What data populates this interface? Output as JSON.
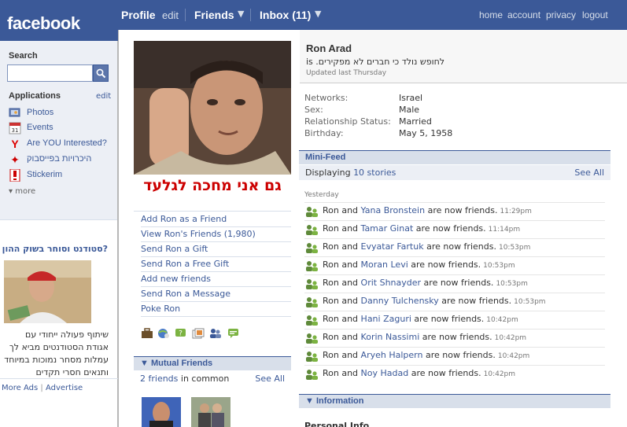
{
  "brand": {
    "logo_text": "facebook"
  },
  "topnav": {
    "profile": "Profile",
    "edit": "edit",
    "friends": "Friends",
    "inbox": "Inbox (11)",
    "home": "home",
    "account": "account",
    "privacy": "privacy",
    "logout": "logout"
  },
  "sidebar": {
    "search_label": "Search",
    "applications_label": "Applications",
    "applications_edit": "edit",
    "apps": [
      {
        "label": "Photos",
        "icon": "photos-icon"
      },
      {
        "label": "Events",
        "icon": "calendar-icon"
      },
      {
        "label": "Are YOU Interested?",
        "icon": "y-icon"
      },
      {
        "label": "היכרויות בפייסבוק",
        "icon": "heart-icon"
      },
      {
        "label": "Stickerim",
        "icon": "exclamation-icon"
      }
    ],
    "more": "more",
    "ad_title": "?סטודנט וסוחר בשוק ההון",
    "ad_text": "שיתוף פעולה ייחודי עם אגודת הסטודנטים מביא לך עמלות מסחר נמוכות במיוחד ותנאים חסרי תקדים",
    "footer_more_ads": "More Ads",
    "footer_sep": "|",
    "footer_advertise": "Advertise"
  },
  "profile": {
    "name": "Ron Arad",
    "status_is": "is",
    "status_text": "לחופש נולד כי חברים לא מפקירים.",
    "updated": "Updated last Thursday",
    "photo_caption": "גם אני מחכה לגלעד",
    "actions": [
      "Add Ron as a Friend",
      "View Ron's Friends (1,980)",
      "Send Ron a Gift",
      "Send Ron a Free Gift",
      "Add new friends",
      "Send Ron a Message",
      "Poke Ron"
    ],
    "info": [
      {
        "label": "Networks:",
        "value": "Israel"
      },
      {
        "label": "Sex:",
        "value": "Male"
      },
      {
        "label": "Relationship Status:",
        "value": "Married"
      },
      {
        "label": "Birthday:",
        "value": "May 5, 1958"
      }
    ]
  },
  "minifeed": {
    "title": "Mini-Feed",
    "displaying_prefix": "Displaying",
    "displaying_link": "10 stories",
    "see_all": "See All",
    "day_label": "Yesterday",
    "items": [
      {
        "actor": "Ron and",
        "friend": "Yana Bronstein",
        "suffix": "are now friends.",
        "time": "11:29pm"
      },
      {
        "actor": "Ron and",
        "friend": "Tamar Ginat",
        "suffix": "are now friends.",
        "time": "11:14pm"
      },
      {
        "actor": "Ron and",
        "friend": "Evyatar Fartuk",
        "suffix": "are now friends.",
        "time": "10:53pm"
      },
      {
        "actor": "Ron and",
        "friend": "Moran Levi",
        "suffix": "are now friends.",
        "time": "10:53pm"
      },
      {
        "actor": "Ron and",
        "friend": "Orit Shnayder",
        "suffix": "are now friends.",
        "time": "10:53pm"
      },
      {
        "actor": "Ron and",
        "friend": "Danny Tulchensky",
        "suffix": "are now friends.",
        "time": "10:53pm"
      },
      {
        "actor": "Ron and",
        "friend": "Hani Zaguri",
        "suffix": "are now friends.",
        "time": "10:42pm"
      },
      {
        "actor": "Ron and",
        "friend": "Korin Nassimi",
        "suffix": "are now friends.",
        "time": "10:42pm"
      },
      {
        "actor": "Ron and",
        "friend": "Aryeh Halpern",
        "suffix": "are now friends.",
        "time": "10:42pm"
      },
      {
        "actor": "Ron and",
        "friend": "Noy Hadad",
        "suffix": "are now friends.",
        "time": "10:42pm"
      }
    ]
  },
  "mutual_friends": {
    "title": "Mutual Friends",
    "count_link": "2 friends",
    "count_suffix": "in common",
    "see_all": "See All"
  },
  "information": {
    "title": "Information",
    "personal_info": "Personal Info"
  },
  "colors": {
    "brand_blue": "#3b5998",
    "light_blue": "#d8dfea",
    "caption_red": "#cc0000"
  }
}
